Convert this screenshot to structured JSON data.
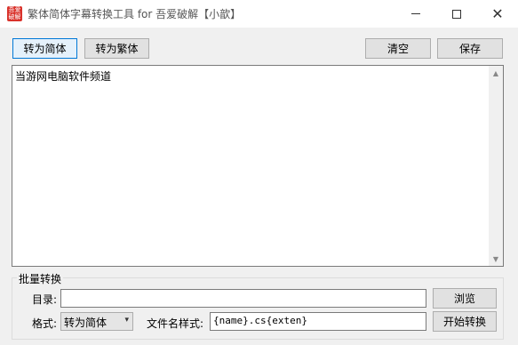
{
  "window": {
    "title": "繁体简体字幕转换工具 for 吾爱破解【小歆】",
    "icon_lines": [
      "吾爱",
      "破解"
    ],
    "minimize_icon": "minimize-icon",
    "maximize_icon": "maximize-icon",
    "close_icon": "close-icon"
  },
  "toolbar": {
    "to_simplified": "转为简体",
    "to_traditional": "转为繁体",
    "clear": "清空",
    "save": "保存"
  },
  "editor": {
    "content": "当游网电脑软件频道",
    "scroll_up_glyph": "▲",
    "scroll_down_glyph": "▼"
  },
  "batch": {
    "legend": "批量转换",
    "directory_label": "目录:",
    "directory_value": "",
    "browse": "浏览",
    "format_label": "格式:",
    "format_value": "转为简体",
    "caret": "▾",
    "filename_label": "文件名样式:",
    "filename_value": "{name}.cs{exten}",
    "start": "开始转换"
  }
}
